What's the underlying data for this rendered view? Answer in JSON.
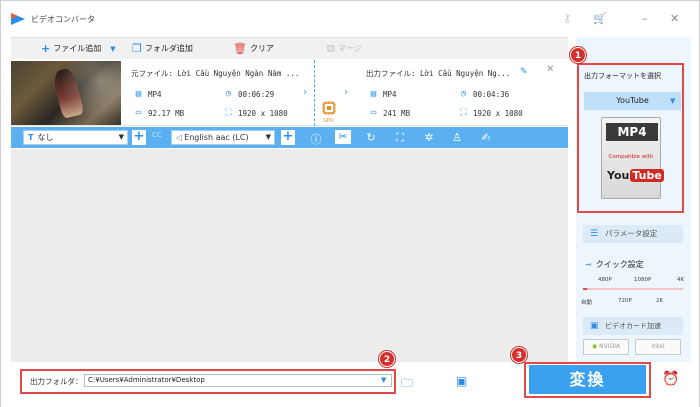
{
  "window": {
    "title": "ビデオコンバータ"
  },
  "toolbar": {
    "add_file": "ファイル追加",
    "add_folder": "フォルダ追加",
    "clear": "クリア",
    "merge": "マージ"
  },
  "file": {
    "source_label": "元ファイル: Lời Cầu Nguyện Ngàn Năm ...",
    "output_label": "出力ファイル: Lời Cầu Nguyện Ng...",
    "src_format": "MP4",
    "src_duration": "00:06:29",
    "src_size": "92.17 MB",
    "src_resolution": "1920 x 1080",
    "dst_format": "MP4",
    "dst_duration": "00:04:36",
    "dst_size": "241 MB",
    "dst_resolution": "1920 x 1080",
    "gpu_label": "GPU"
  },
  "editbar": {
    "subtitle": "なし",
    "cc": "CC",
    "audio": "English aac (LC)"
  },
  "bottom": {
    "output_folder_label": "出力フォルダ：",
    "output_path": "C:¥Users¥Administrator¥Desktop",
    "convert": "変換"
  },
  "badges": {
    "b1": "1",
    "b2": "2",
    "b3": "3"
  },
  "panel": {
    "format_title": "出力フォーマットを選択",
    "format_value": "YouTube",
    "card_mp4": "MP4",
    "card_compat": "Compatible with",
    "card_you": "You",
    "card_tube": "Tube",
    "params": "パラメータ設定",
    "quick": "クイック設定",
    "ticks_top": [
      "480P",
      "1080P",
      "4K"
    ],
    "ticks_bottom": [
      "自動",
      "720P",
      "2K"
    ],
    "gpu_accel": "ビデオカード加速",
    "nvidia": "NVIDIA",
    "intel": "Intel"
  },
  "colors": {
    "accent": "#3aa0f0",
    "highlight": "#e34949"
  }
}
